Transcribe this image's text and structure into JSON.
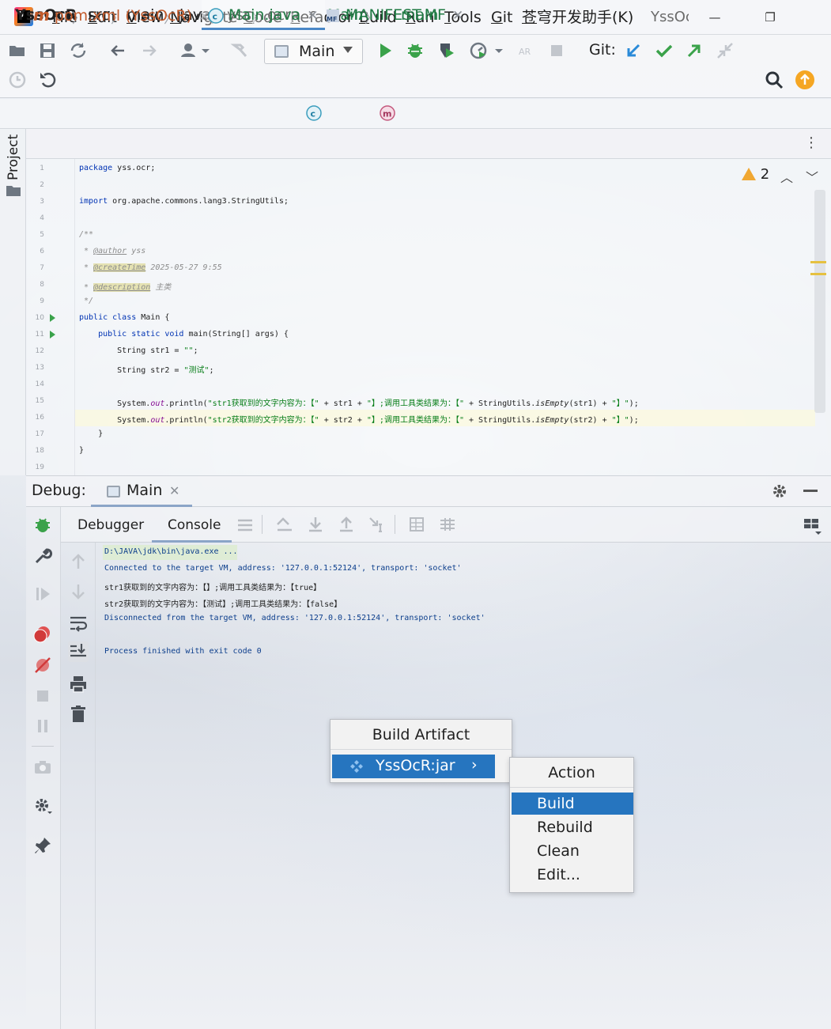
{
  "titlebar": {
    "menus": [
      "File",
      "Edit",
      "View",
      "Navigate",
      "Code",
      "Refactor",
      "Build",
      "Run",
      "Tools",
      "Git",
      "苍穹开发助手(K)"
    ],
    "window_title": "YssOcR",
    "minimize": "—",
    "restore": "❐"
  },
  "toolbar": {
    "run_config": "Main",
    "git_label": "Git:"
  },
  "breadcrumb": [
    "YssOcR",
    "src",
    "main",
    "java",
    "yss",
    "ocr",
    "Main",
    "main"
  ],
  "sidebar": {
    "project_tab": "Project"
  },
  "editor_tabs": [
    {
      "label": "pom.xml (YssOcR)",
      "icon": "maven-icon"
    },
    {
      "label": "Main.java",
      "icon": "java-class-icon"
    },
    {
      "label": "MANIFEST.MF",
      "icon": "manifest-icon"
    }
  ],
  "editor": {
    "warning_count": "2",
    "line_numbers": [
      "1",
      "2",
      "3",
      "4",
      "5",
      "6",
      "7",
      "8",
      "9",
      "10",
      "11",
      "12",
      "13",
      "14",
      "15",
      "16",
      "17",
      "18",
      "19"
    ],
    "code": {
      "l1_kw": "package",
      "l1_rest": " yss.ocr;",
      "l3_kw": "import",
      "l3_rest": " org.apache.commons.lang3.StringUtils;",
      "l5": "/**",
      "l6_star": " * ",
      "l6_tag": "@author",
      "l6_val": " yss",
      "l7_star": " * ",
      "l7_tag": "@createTime",
      "l7_val": " 2025-05-27 9:55",
      "l8_star": " * ",
      "l8_tag": "@description",
      "l8_val": " 主类",
      "l9": " */",
      "l10_kw": "public class",
      "l10_rest": " Main {",
      "l11_kw": "    public static void",
      "l11_rest": " main(String[] args) {",
      "l12_a": "        String str1 = ",
      "l12_s": "\"\"",
      "l12_b": ";",
      "l13_a": "        String str2 = ",
      "l13_s": "\"测试\"",
      "l13_b": ";",
      "l15_a": "        System.",
      "l15_f": "out",
      "l15_b": ".println(",
      "l15_s1": "\"str1获取到的文字内容为：【\"",
      "l15_c": " + str1 + ",
      "l15_s2": "\"】;调用工具类结果为：【\"",
      "l15_d": " + StringUtils.",
      "l15_m": "isEmpty",
      "l15_e": "(str1) + ",
      "l15_s3": "\"】\"",
      "l15_g": ");",
      "l16_a": "        System.",
      "l16_f": "out",
      "l16_b": ".println(",
      "l16_s1": "\"str2获取到的文字内容为：【\"",
      "l16_c": " + str2 + ",
      "l16_s2": "\"】;调用工具类结果为：【\"",
      "l16_d": " + StringUtils.",
      "l16_m": "isEmpty",
      "l16_e": "(str2) + ",
      "l16_s3": "\"】\"",
      "l16_g": ");",
      "l17": "    }",
      "l18": "}"
    }
  },
  "debug": {
    "label": "Debug:",
    "tab": "Main",
    "tabs": [
      "Debugger",
      "Console"
    ],
    "console": [
      "D:\\JAVA\\jdk\\bin\\java.exe ...",
      "Connected to the target VM, address: '127.0.0.1:52124', transport: 'socket'",
      "str1获取到的文字内容为：【】;调用工具类结果为：【true】",
      "str2获取到的文字内容为：【测试】;调用工具类结果为：【false】",
      "Disconnected from the target VM, address: '127.0.0.1:52124', transport: 'socket'",
      "",
      "Process finished with exit code 0"
    ]
  },
  "popup_artifact": {
    "title": "Build Artifact",
    "item": "YssOcR:jar"
  },
  "popup_action": {
    "title": "Action",
    "items": [
      "Build",
      "Rebuild",
      "Clean",
      "Edit..."
    ]
  },
  "colors": {
    "selection": "#2675bf",
    "run_green": "#3aa24a",
    "keyword": "#0033b3",
    "string": "#067d17"
  }
}
